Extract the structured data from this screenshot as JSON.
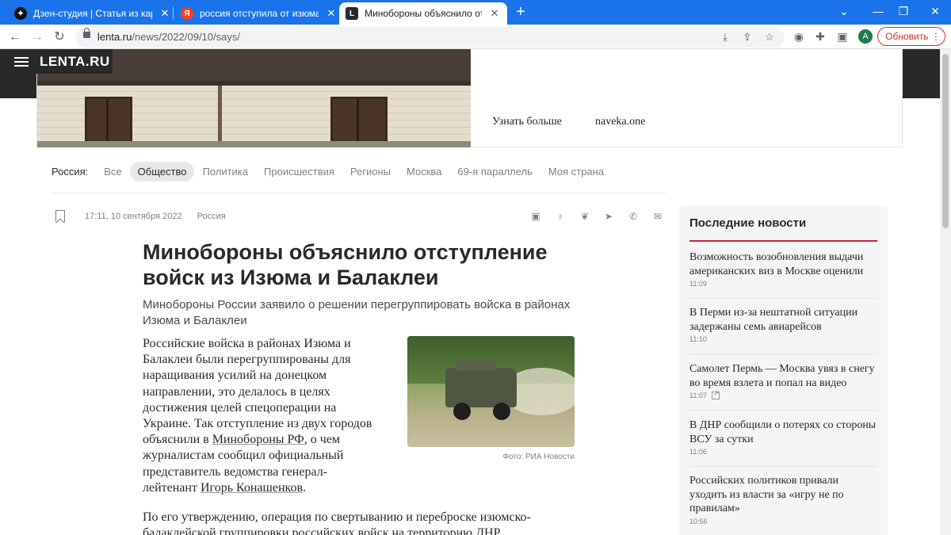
{
  "browser": {
    "tabs": [
      {
        "title": "Дзен-студия | Статья из картинк",
        "favicon": "dzen-icon"
      },
      {
        "title": "россия отступила от изюма — Я",
        "favicon": "yandex-icon"
      },
      {
        "title": "Минобороны объяснило отступ",
        "favicon": "lenta-icon",
        "active": true
      }
    ],
    "url_host": "lenta.ru",
    "url_path": "/news/2022/09/10/says/",
    "avatar_letter": "A",
    "update_label": "Обновить",
    "accent_color": "#1a73e8"
  },
  "site": {
    "logo": "LENTA.RU",
    "ad": {
      "cta": "Узнать больше",
      "domain": "naveka.one"
    }
  },
  "rubrics": {
    "label": "Россия:",
    "items": [
      "Все",
      "Общество",
      "Политика",
      "Происшествия",
      "Регионы",
      "Москва",
      "69-я параллель",
      "Моя страна"
    ],
    "active": "Общество"
  },
  "article": {
    "time": "17:11, 10 сентября 2022",
    "rubric": "Россия",
    "title": "Минобороны объяснило отступление войск из Изюма и Балаклеи",
    "lead": "Минобороны России заявило о решении перегруппировать войска в районах Изюма и Балаклеи",
    "p1": {
      "l1": "Российские войска в районах Изюма и",
      "l2": "Балаклеи были перегруппированы для",
      "l3": "наращивания усилий на донецком",
      "l4": "направлении, это делалось в целях",
      "l5": "достижения целей спецоперации на",
      "l6": "Украине. Так отступление из двух городов",
      "l7_a": "объяснили в ",
      "l7_link": "Минобороны РФ",
      "l7_b": ", о чем",
      "l8": "журналистам сообщил официальный",
      "l9": "представитель ведомства генерал-",
      "l10_a": "лейтенант ",
      "l10_link": "Игорь Конашенков",
      "l10_b": "."
    },
    "p2": {
      "l1": "По его утверждению, операция по свертыванию и переброске изюмско-",
      "l2": "балаклейской группировки российских войск на территорию ДНР"
    },
    "photo_caption": "Фото: РИА Новости"
  },
  "sidebar": {
    "title": "Последние новости",
    "accent_color": "#d21e32",
    "items": [
      {
        "title": "Возможность возобновления выдачи американских виз в Москве оценили",
        "time": "11:09"
      },
      {
        "title": "В Перми из-за нештатной ситуации задержаны семь авиарейсов",
        "time": "11:10"
      },
      {
        "title": "Самолет Пермь — Москва увяз в снегу во время взлета и попал на видео",
        "time": "11:07",
        "external": true
      },
      {
        "title": "В ДНР сообщили о потерях со стороны ВСУ за сутки",
        "time": "11:06"
      },
      {
        "title": "Российских политиков привали уходить из власти за «игру не по правилам»",
        "time": "10:56"
      }
    ]
  },
  "share_icons": [
    "vk-icon",
    "ok-icon",
    "twitter-icon",
    "telegram-icon",
    "whatsapp-icon",
    "mail-icon"
  ]
}
